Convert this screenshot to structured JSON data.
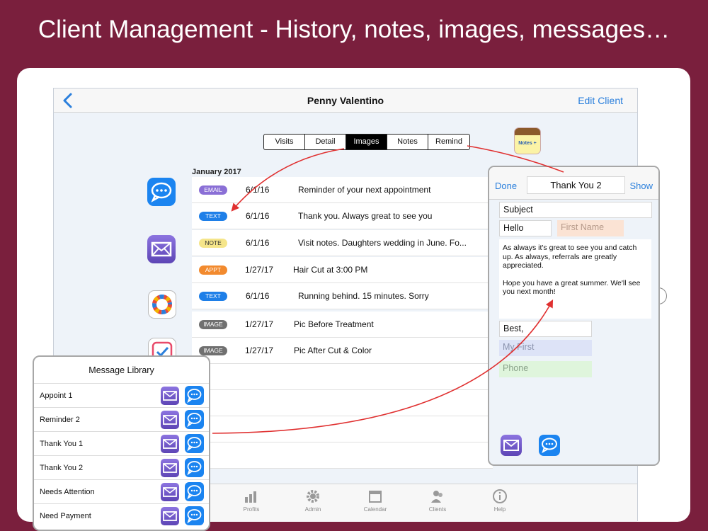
{
  "headline": "Client Management - History, notes, images, messages…",
  "navbar": {
    "title": "Penny Valentino",
    "edit_label": "Edit Client"
  },
  "segments": [
    "Visits",
    "Detail",
    "Images",
    "Notes",
    "Remind"
  ],
  "active_segment": "Images",
  "notes_app_label": "Notes +",
  "history": {
    "month": "January 2017",
    "rows": [
      {
        "badge": "EMAIL",
        "date": "6/1/16",
        "desc": "Reminder of your next appointment"
      },
      {
        "badge": "TEXT",
        "date": "6/1/16",
        "desc": "Thank you.  Always great to see you"
      },
      {
        "badge": "NOTE",
        "date": "6/1/16",
        "desc": "Visit notes.  Daughters wedding in June. Fo..."
      },
      {
        "badge": "APPT",
        "date": "1/27/17",
        "desc": "Hair Cut at 3:00 PM"
      },
      {
        "badge": "TEXT",
        "date": "6/1/16",
        "desc": "Running behind. 15 minutes. Sorry"
      },
      {
        "badge": "IMAGE",
        "date": "1/27/17",
        "desc": "Pic Before Treatment"
      },
      {
        "badge": "IMAGE",
        "date": "1/27/17",
        "desc": "Pic After Cut & Color"
      }
    ]
  },
  "tabbar": [
    "Profits",
    "Admin",
    "Calendar",
    "Clients",
    "Help"
  ],
  "compose": {
    "done": "Done",
    "title": "Thank You 2",
    "show": "Show",
    "subject": "Subject",
    "greeting": "Hello",
    "first_name_placeholder": "First Name",
    "body_1": "As always it's great to see you and catch up.  As always, referrals are greatly appreciated.",
    "body_2": "Hope you have a great summer.  We'll see you next month!",
    "signoff": "Best,",
    "my_first": "My First",
    "phone": "Phone"
  },
  "library": {
    "title": "Message Library",
    "items": [
      "Appoint 1",
      "Reminder 2",
      "Thank You 1",
      "Thank You 2",
      "Needs Attention",
      "Need Payment"
    ]
  },
  "colors": {
    "background": "#7a1f3d",
    "accent": "#2a7fdc",
    "arrow": "#e03030",
    "email": "#8a6fd6",
    "text": "#1e7fe8",
    "note": "#f5e58a",
    "appt": "#f28a2e",
    "image": "#707070"
  },
  "icons": [
    "back-chevron-icon",
    "notes-app-icon",
    "messages-icon",
    "mail-icon",
    "photos-icon",
    "reminders-icon",
    "profits-icon",
    "admin-gear-icon",
    "calendar-icon",
    "clients-icon",
    "help-icon"
  ]
}
